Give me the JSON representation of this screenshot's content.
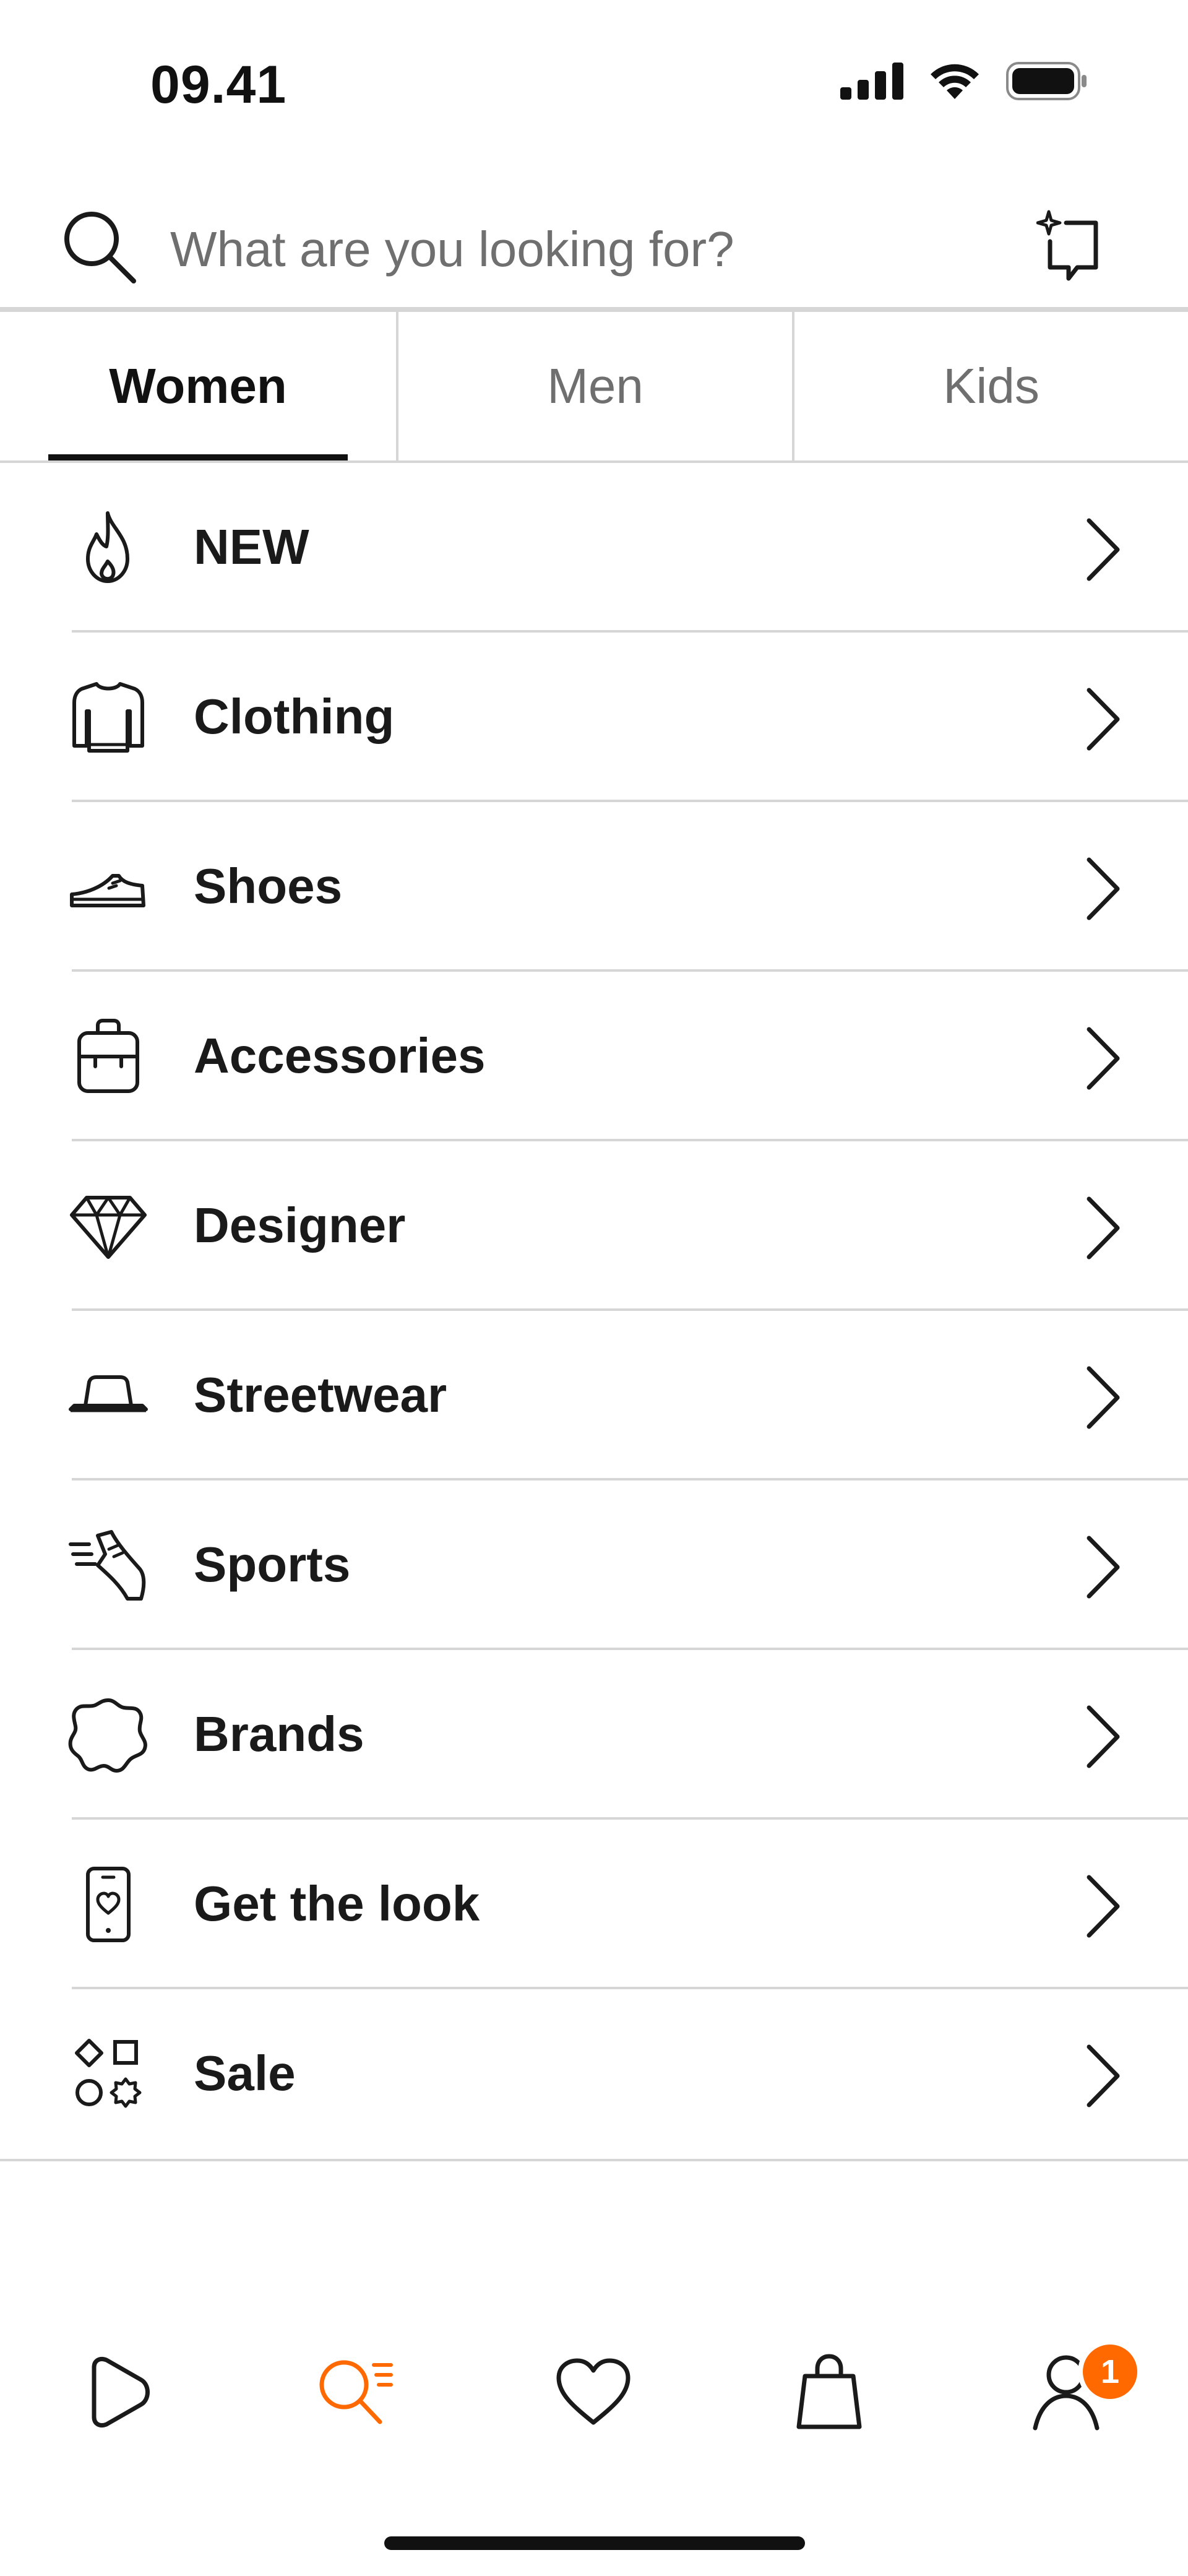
{
  "status_bar": {
    "time": "09.41",
    "icons": [
      "cellular-signal-icon",
      "wifi-icon",
      "battery-icon"
    ]
  },
  "search": {
    "placeholder": "What are you looking for?",
    "value": "",
    "icons": [
      "search-icon",
      "ai-search-icon"
    ]
  },
  "tabs": [
    {
      "label": "Women",
      "active": true
    },
    {
      "label": "Men",
      "active": false
    },
    {
      "label": "Kids",
      "active": false
    }
  ],
  "categories": [
    {
      "label": "NEW",
      "icon": "flame-icon"
    },
    {
      "label": "Clothing",
      "icon": "sweater-icon"
    },
    {
      "label": "Shoes",
      "icon": "sneaker-icon"
    },
    {
      "label": "Accessories",
      "icon": "backpack-icon"
    },
    {
      "label": "Designer",
      "icon": "diamond-icon"
    },
    {
      "label": "Streetwear",
      "icon": "bucket-hat-icon"
    },
    {
      "label": "Sports",
      "icon": "running-shoe-icon"
    },
    {
      "label": "Brands",
      "icon": "badge-icon"
    },
    {
      "label": "Get the look",
      "icon": "phone-heart-icon"
    },
    {
      "label": "Sale",
      "icon": "shapes-icon"
    }
  ],
  "bottom_nav": {
    "items": [
      {
        "name": "discover",
        "icon": "play-icon",
        "active": false
      },
      {
        "name": "categories",
        "icon": "search-list-icon",
        "active": true
      },
      {
        "name": "wishlist",
        "icon": "heart-icon",
        "active": false
      },
      {
        "name": "bag",
        "icon": "shopping-bag-icon",
        "active": false
      },
      {
        "name": "profile",
        "icon": "user-icon",
        "active": false
      }
    ],
    "profile_badge": "1"
  },
  "colors": {
    "accent": "#ff6900",
    "text": "#1a1a1a",
    "muted_text": "#6f6f6f",
    "divider": "#d6d6d6",
    "background": "#ffffff"
  }
}
